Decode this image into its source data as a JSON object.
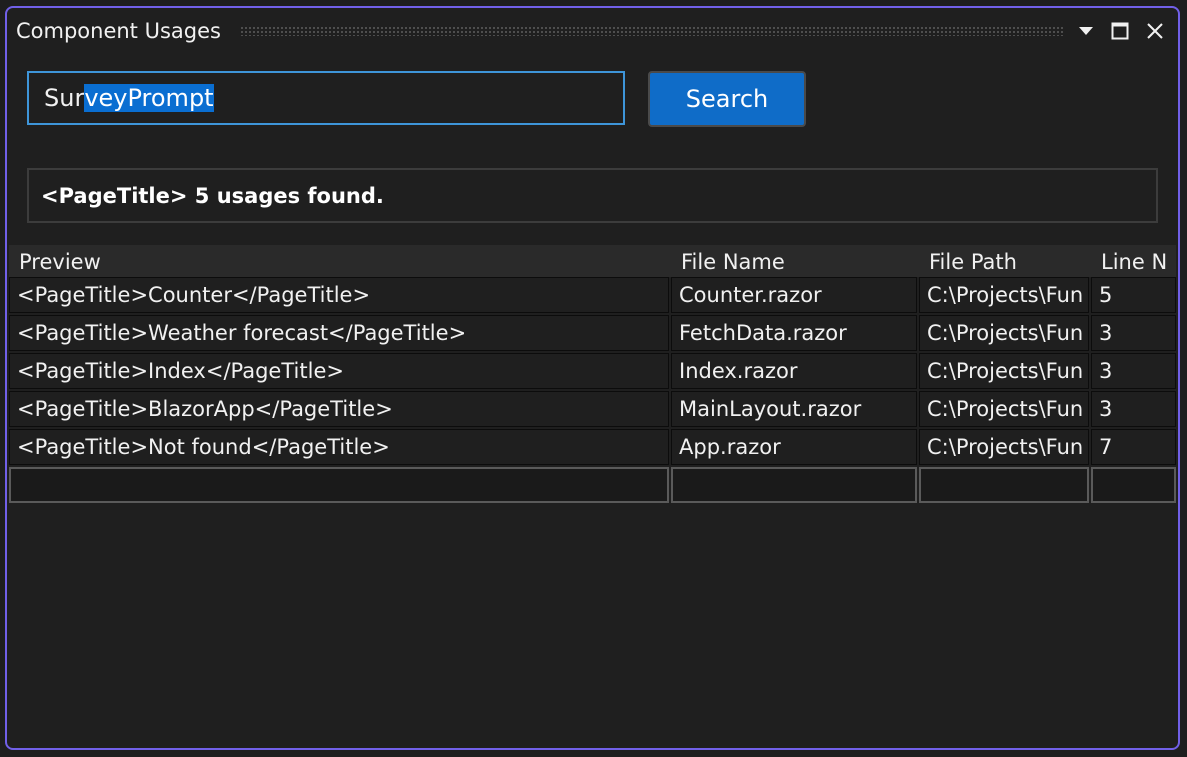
{
  "window": {
    "title": "Component Usages",
    "controls": {
      "dropdown_icon": "chevron-down-icon",
      "maximize_icon": "maximize-icon",
      "close_icon": "close-icon"
    }
  },
  "search": {
    "value_unselected": "Sur",
    "value_selected": "veyPrompt",
    "button_label": "Search"
  },
  "status": {
    "message": "<PageTitle> 5 usages found."
  },
  "table": {
    "columns": [
      "Preview",
      "File Name",
      "File Path",
      "Line N"
    ],
    "rows": [
      [
        "<PageTitle>Counter</PageTitle>",
        "Counter.razor",
        "C:\\Projects\\Fun",
        "5"
      ],
      [
        "<PageTitle>Weather forecast</PageTitle>",
        "FetchData.razor",
        "C:\\Projects\\Fun",
        "3"
      ],
      [
        "<PageTitle>Index</PageTitle>",
        "Index.razor",
        "C:\\Projects\\Fun",
        "3"
      ],
      [
        "<PageTitle>BlazorApp</PageTitle>",
        "MainLayout.razor",
        "C:\\Projects\\Fun",
        "3"
      ],
      [
        "<PageTitle>Not found</PageTitle>",
        "App.razor",
        "C:\\Projects\\Fun",
        "7"
      ]
    ]
  },
  "colors": {
    "window_border": "#7160e8",
    "accent": "#0f6cc8",
    "selection": "#0a6ed1",
    "input_border": "#3e95d9"
  }
}
